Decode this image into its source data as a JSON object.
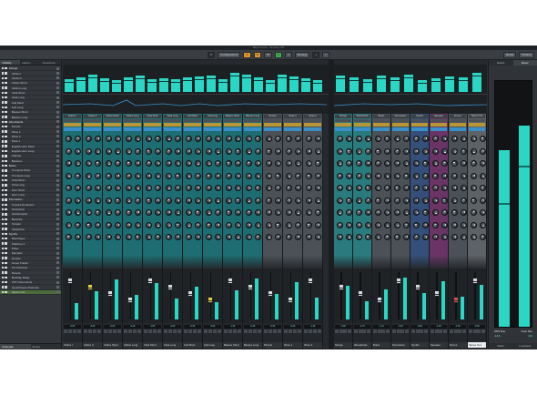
{
  "window": {
    "title": "MixConsole - Tembury P4"
  },
  "toolbar": {
    "configurations": "Configurations",
    "btn_r": "R",
    "btn_w": "W",
    "btn_m": "M",
    "btn_s": "S",
    "routing": "Routing",
    "racks": "Racks",
    "window_btn": "Window"
  },
  "left_zone": {
    "tabs": [
      "Visibility",
      "History",
      "Snapshots"
    ],
    "channels": [
      {
        "name": "Strings",
        "folder": true
      },
      {
        "name": "Violins I"
      },
      {
        "name": "Violins II"
      },
      {
        "name": "Violins Short"
      },
      {
        "name": "Violins Long"
      },
      {
        "name": "Viola Short"
      },
      {
        "name": "Viola Long"
      },
      {
        "name": "Cell Short"
      },
      {
        "name": "Cell Long"
      },
      {
        "name": "Basses Short"
      },
      {
        "name": "Basses Long"
      },
      {
        "name": "Woodwinds",
        "folder": true
      },
      {
        "name": "Piccolo"
      },
      {
        "name": "Oboe 1"
      },
      {
        "name": "Oboe 2"
      },
      {
        "name": "Flute 1"
      },
      {
        "name": "English Horn Short"
      },
      {
        "name": "English Horn Long"
      },
      {
        "name": "Clarinet"
      },
      {
        "name": "Bassoon"
      },
      {
        "name": "Brass",
        "folder": true
      },
      {
        "name": "Trumpets Short"
      },
      {
        "name": "Trumpets Long"
      },
      {
        "name": "Tuba Short"
      },
      {
        "name": "Tuba Long"
      },
      {
        "name": "Horn Short"
      },
      {
        "name": "Horn Long"
      },
      {
        "name": "Percussion",
        "folder": true
      },
      {
        "name": "Timpani Dynamics"
      },
      {
        "name": "Orchestral"
      },
      {
        "name": "Glockenspiel"
      },
      {
        "name": "Marimba"
      },
      {
        "name": "Tubular"
      },
      {
        "name": "Xylophone"
      },
      {
        "name": "Synths",
        "folder": true
      },
      {
        "name": "Retrologue"
      },
      {
        "name": "Padshop 2"
      },
      {
        "name": "Pulse"
      },
      {
        "name": "Samples"
      },
      {
        "name": "Groups"
      },
      {
        "name": "Group Tracks"
      },
      {
        "name": "FX Channels"
      },
      {
        "name": "Reverb"
      },
      {
        "name": "MultiTap Delay"
      },
      {
        "name": "VST Instruments"
      },
      {
        "name": "Input/Output Channels"
      },
      {
        "name": "Stereo Out",
        "selected": true
      }
    ],
    "bottom_tabs": [
      "Channels",
      "Zones"
    ]
  },
  "mixer": {
    "strips": [
      {
        "name": "Violins I",
        "db": "-2.50",
        "theme": "teal"
      },
      {
        "name": "Violins II",
        "db": "-3.30",
        "theme": "teal"
      },
      {
        "name": "Violins Short",
        "db": "-0.00",
        "theme": "teal"
      },
      {
        "name": "Violins Long",
        "db": "-4.10",
        "theme": "teal"
      },
      {
        "name": "Viola Short",
        "db": "-1.80",
        "theme": "teal"
      },
      {
        "name": "Viola Long",
        "db": "-2.00",
        "theme": "teal"
      },
      {
        "name": "Cell Short",
        "db": "-0.60",
        "theme": "teal"
      },
      {
        "name": "Cell Long",
        "db": "-3.90",
        "theme": "teal"
      },
      {
        "name": "Basses Short",
        "db": "-1.20",
        "theme": "teal"
      },
      {
        "name": "Basses Long",
        "db": "-2.40",
        "theme": "teal"
      },
      {
        "name": "Piccolo",
        "db": "-5.00",
        "theme": "grey"
      },
      {
        "name": "Oboe 1",
        "db": "-2.20",
        "theme": "grey"
      },
      {
        "name": "Oboe 2",
        "db": "-1.40",
        "theme": "grey"
      },
      {
        "name": "Strings",
        "db": "-0.00",
        "theme": "teal2"
      },
      {
        "name": "Woodwinds",
        "db": "-2.70",
        "theme": "teal2"
      },
      {
        "name": "Brass",
        "db": "-1.10",
        "theme": "grey"
      },
      {
        "name": "Percussion",
        "db": "-3.40",
        "theme": "grey"
      },
      {
        "name": "Synths",
        "db": "-0.90",
        "theme": "blue"
      },
      {
        "name": "Samples",
        "db": "-4.20",
        "theme": "purple"
      },
      {
        "name": "Drums",
        "db": "-1.50",
        "theme": "grey"
      },
      {
        "name": "Stereo Out",
        "db": "-0.00",
        "theme": "grey2",
        "selected": true
      }
    ]
  },
  "right_zone": {
    "tabs": [
      "Racks",
      "Meter"
    ],
    "meter_labels": [
      "RMS Max",
      "Peak Max"
    ],
    "meter_values": [
      "-14.6",
      "-6.6"
    ],
    "meter_levels": [
      0.72,
      0.82
    ],
    "footer": [
      "Meter",
      "Loudness"
    ]
  },
  "colors": {
    "meter": "#2ad6c4",
    "accent_orange": "#e0962c",
    "accent_green": "#3dae4d"
  }
}
